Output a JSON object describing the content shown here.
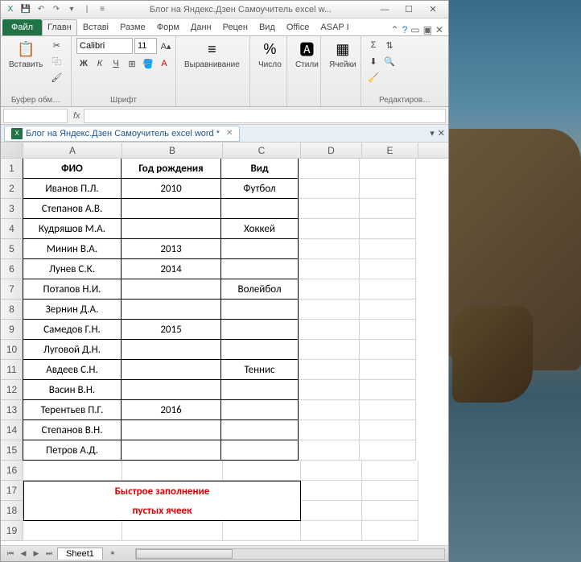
{
  "window": {
    "title": "Блог на Яндекс.Дзен Самоучитель excel w..."
  },
  "ribbon": {
    "tabs": {
      "file": "Файл",
      "home": "Главн",
      "insert": "Вставі",
      "layout": "Разме",
      "formulas": "Форм",
      "data": "Данн",
      "review": "Рецен",
      "view": "Вид",
      "office": "Office",
      "asap": "ASAP I"
    },
    "groups": {
      "clipboard": "Буфер обм…",
      "clipboard_paste": "Вставить",
      "font": "Шрифт",
      "font_name": "Calibri",
      "font_size": "11",
      "alignment": "Выравнивание",
      "number": "Число",
      "styles": "Стили",
      "cells": "Ячейки",
      "editing": "Редактиров…"
    }
  },
  "doc_tab": {
    "name": "Блог на Яндекс.Дзен Самоучитель excel word *"
  },
  "columns": [
    "A",
    "B",
    "C",
    "D",
    "E"
  ],
  "rows": [
    "1",
    "2",
    "3",
    "4",
    "5",
    "6",
    "7",
    "8",
    "9",
    "10",
    "11",
    "12",
    "13",
    "14",
    "15",
    "16",
    "17",
    "18",
    "19"
  ],
  "headers": {
    "A": "ФИО",
    "B": "Год рождения",
    "C": "Вид"
  },
  "data": [
    {
      "A": "Иванов П.Л.",
      "B": "2010",
      "C": "Футбол"
    },
    {
      "A": "Степанов А.В.",
      "B": "",
      "C": ""
    },
    {
      "A": "Кудряшов М.А.",
      "B": "",
      "C": "Хоккей"
    },
    {
      "A": "Минин В.А.",
      "B": "2013",
      "C": ""
    },
    {
      "A": "Лунев С.К.",
      "B": "2014",
      "C": ""
    },
    {
      "A": "Потапов Н.И.",
      "B": "",
      "C": "Волейбол"
    },
    {
      "A": "Зернин Д.А.",
      "B": "",
      "C": ""
    },
    {
      "A": "Самедов Г.Н.",
      "B": "2015",
      "C": ""
    },
    {
      "A": "Луговой Д.Н.",
      "B": "",
      "C": ""
    },
    {
      "A": "Авдеев С.Н.",
      "B": "",
      "C": "Теннис"
    },
    {
      "A": "Васин В.Н.",
      "B": "",
      "C": ""
    },
    {
      "A": "Терентьев П.Г.",
      "B": "2016",
      "C": ""
    },
    {
      "A": "Степанов В.Н.",
      "B": "",
      "C": ""
    },
    {
      "A": "Петров А.Д.",
      "B": "",
      "C": ""
    }
  ],
  "note": {
    "line1": "Быстрое заполнение",
    "line2": "пустых ячеек"
  },
  "sheet_tab": "Sheet1",
  "formula_bar": {
    "name_box": "",
    "fx": "fx"
  }
}
